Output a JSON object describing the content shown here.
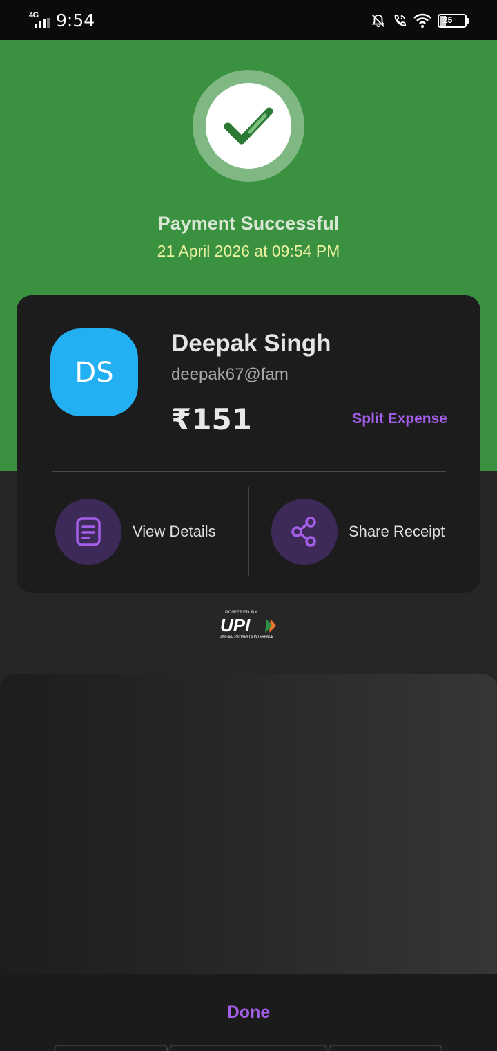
{
  "status_bar": {
    "network": "4G",
    "time": "9:54",
    "battery": "25",
    "icons": [
      "signal-bars-icon",
      "bell-muted-icon",
      "wifi-call-icon",
      "wifi-icon",
      "battery-icon"
    ]
  },
  "header": {
    "icon": "checkmark-icon",
    "title": "Payment Successful",
    "datetime": "21 April 2026 at 09:54 PM"
  },
  "payee": {
    "initials": "DS",
    "name": "Deepak Singh",
    "upi_id": "deepak67@fam",
    "amount": "₹151",
    "split_label": "Split Expense"
  },
  "actions": [
    {
      "label": "View Details",
      "icon": "document-icon"
    },
    {
      "label": "Share Receipt",
      "icon": "share-icon"
    }
  ],
  "upi_logo": {
    "top_text": "POWERED BY",
    "main_text": "UPI",
    "sub_text": "UNIFIED PAYMENTS INTERFACE"
  },
  "footer": {
    "done_label": "Done"
  },
  "colors": {
    "success_green": "#3a913f",
    "accent_purple": "#a45ee8",
    "avatar_blue": "#23b0f2",
    "card_bg": "#1c1c1d"
  }
}
